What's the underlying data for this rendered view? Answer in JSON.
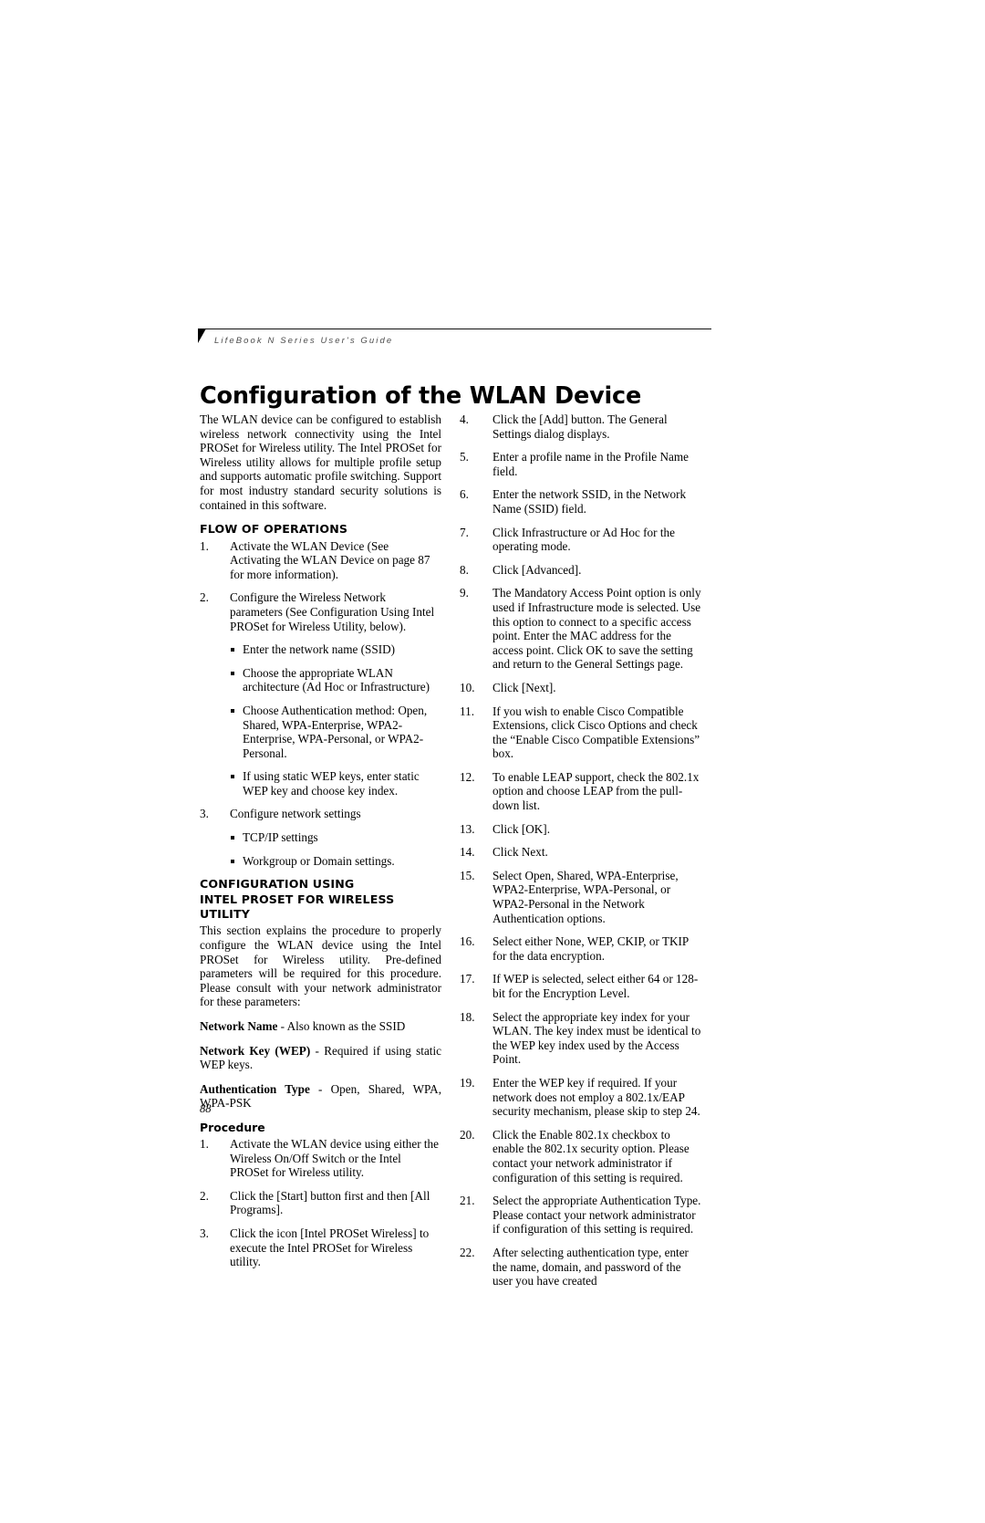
{
  "header": {
    "running_title": "LifeBook N Series User's Guide",
    "page_title": "Configuration of the WLAN Device"
  },
  "folio": {
    "page_number": "88"
  },
  "left_column": {
    "intro": "The WLAN device can be configured to establish wireless network connectivity using the Intel PROSet for Wireless utility. The Intel PROSet for Wireless utility allows for multiple profile setup and supports automatic profile switching. Support for most industry standard security solutions is contained in this software.",
    "flow_heading": "FLOW OF OPERATIONS",
    "flow_items": [
      {
        "num": "1.",
        "text": "Activate the WLAN Device (See Activating the WLAN Device on page 87 for more information)."
      },
      {
        "num": "2.",
        "text": "Configure the Wireless Network parameters (See Configuration Using Intel PROSet for Wireless Utility, below).",
        "bullets": [
          "Enter the network name (SSID)",
          "Choose the appropriate WLAN architecture (Ad Hoc or Infrastructure)",
          "Choose Authentication method: Open, Shared, WPA-Enterprise, WPA2-Enterprise, WPA-Personal, or WPA2-Personal.",
          "If using static WEP keys, enter static WEP key and choose key index."
        ]
      },
      {
        "num": "3.",
        "text": "Configure network settings",
        "bullets": [
          "TCP/IP settings",
          "Workgroup or Domain settings."
        ]
      }
    ],
    "config_heading_line1": "CONFIGURATION USING",
    "config_heading_line2": "INTEL PROSET FOR WIRELESS UTILITY",
    "config_intro": "This section explains the procedure to properly configure the WLAN device using the Intel PROSet for Wireless utility. Pre-defined parameters will be required for this procedure. Please consult with your network administrator for these parameters:",
    "params": [
      {
        "term": "Network Name",
        "rest": " - Also known as the SSID"
      },
      {
        "term": "Network Key (WEP)",
        "rest": " - Required if using static WEP keys."
      },
      {
        "term": "Authentication Type",
        "rest": " - Open, Shared, WPA, WPA-PSK"
      }
    ],
    "procedure_heading": "Procedure",
    "procedure_items": [
      {
        "num": "1.",
        "text": "Activate the WLAN device using either the Wireless On/Off Switch or the Intel PROSet for Wireless utility."
      },
      {
        "num": "2.",
        "text": "Click the [Start] button first and then [All Programs]."
      },
      {
        "num": "3.",
        "text": "Click the icon [Intel PROSet Wireless] to execute the Intel PROSet for Wireless utility."
      }
    ]
  },
  "right_column": {
    "items": [
      {
        "num": "4.",
        "text": "Click the [Add] button. The General Settings dialog displays."
      },
      {
        "num": "5.",
        "text": "Enter a profile name in the Profile Name field."
      },
      {
        "num": "6.",
        "text": "Enter the network SSID, in the Network Name (SSID) field."
      },
      {
        "num": "7.",
        "text": "Click Infrastructure or Ad Hoc for the operating mode."
      },
      {
        "num": "8.",
        "text": "Click [Advanced]."
      },
      {
        "num": "9.",
        "text": "The Mandatory Access Point option is only used if Infrastructure mode is selected. Use this option to connect to a specific access point. Enter the MAC address for the access point. Click OK to save the setting and return to the General Settings page."
      },
      {
        "num": "10.",
        "text": "Click [Next]."
      },
      {
        "num": "11.",
        "text": "If you wish to enable Cisco Compatible Extensions, click Cisco Options and check the “Enable Cisco Compatible Extensions” box."
      },
      {
        "num": "12.",
        "text": "To enable LEAP support, check the 802.1x option and choose LEAP from the pull-down list."
      },
      {
        "num": "13.",
        "text": "Click [OK]."
      },
      {
        "num": "14.",
        "text": "Click Next."
      },
      {
        "num": "15.",
        "text": "Select Open, Shared, WPA-Enterprise, WPA2-Enterprise, WPA-Personal, or WPA2-Personal in the Network Authentication options."
      },
      {
        "num": "16.",
        "text": "Select either None, WEP, CKIP, or TKIP for the data encryption."
      },
      {
        "num": "17.",
        "text": "If WEP is selected, select either 64 or 128-bit for the Encryption Level."
      },
      {
        "num": "18.",
        "text": "Select the appropriate key index for your WLAN. The key index must be identical to the WEP key index used by the Access Point."
      },
      {
        "num": "19.",
        "text": "Enter the WEP key if required. If your network does not employ a 802.1x/EAP security mechanism, please skip to step 24."
      },
      {
        "num": "20.",
        "text": "Click the Enable 802.1x checkbox to enable the 802.1x security option. Please contact your network administrator if configuration of this setting is required."
      },
      {
        "num": "21.",
        "text": "Select the appropriate Authentication Type. Please contact your network administrator if configuration of this setting is required."
      },
      {
        "num": "22.",
        "text": "After selecting authentication type, enter the name, domain, and password of the user you have created"
      }
    ]
  }
}
